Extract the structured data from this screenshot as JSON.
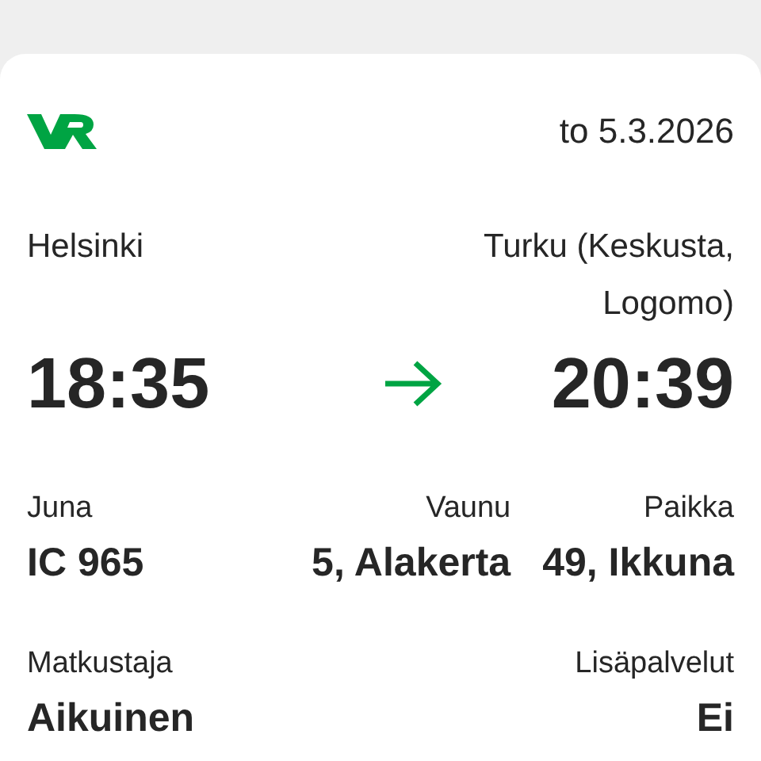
{
  "header": {
    "date": "to 5.3.2026"
  },
  "route": {
    "origin": "Helsinki",
    "destination": "Turku (Keskusta, Logomo)",
    "departure": "18:35",
    "arrival": "20:39"
  },
  "details": [
    {
      "label": "Juna",
      "value": "IC 965"
    },
    {
      "label": "Vaunu",
      "value": "5, Alakerta"
    },
    {
      "label": "Paikka",
      "value": "49, Ikkuna"
    }
  ],
  "extras": [
    {
      "label": "Matkustaja",
      "value": "Aikuinen"
    },
    {
      "label": "Lisäpalvelut",
      "value": "Ei"
    }
  ]
}
